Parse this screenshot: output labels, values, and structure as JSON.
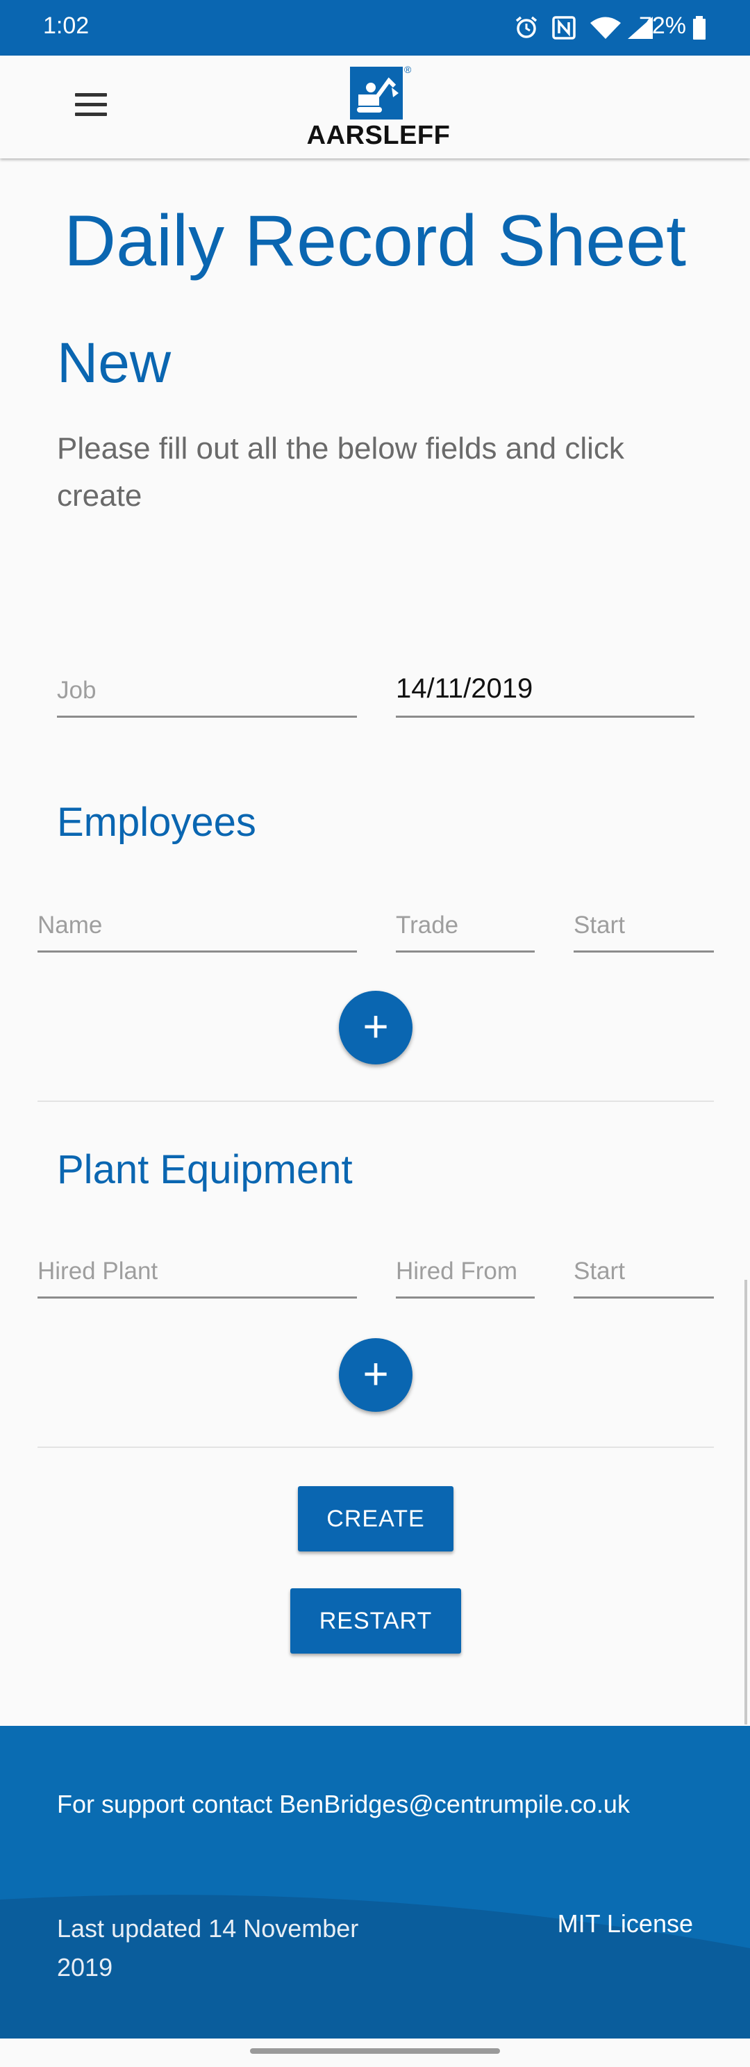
{
  "status_bar": {
    "time": "1:02",
    "battery_percent": "72%",
    "icons": [
      "alarm-icon",
      "nfc-icon",
      "wifi-icon",
      "signal-icon",
      "battery-icon"
    ]
  },
  "header": {
    "logo_text": "AARSLEFF",
    "logo_mark": "®"
  },
  "page": {
    "title": "Daily Record Sheet",
    "subtitle": "New",
    "description": "Please fill out all the below fields and click create"
  },
  "job_form": {
    "job_placeholder": "Job",
    "date_value": "14/11/2019"
  },
  "employees": {
    "heading": "Employees",
    "name_placeholder": "Name",
    "trade_placeholder": "Trade",
    "start_placeholder": "Start",
    "add_symbol": "+"
  },
  "plant": {
    "heading": "Plant Equipment",
    "hired_plant_placeholder": "Hired Plant",
    "hired_from_placeholder": "Hired From",
    "start_placeholder": "Start",
    "add_symbol": "+"
  },
  "actions": {
    "create_label": "CREATE",
    "restart_label": "RESTART"
  },
  "footer": {
    "support_text": "For support contact BenBridges@centrumpile.co.uk",
    "updated_text": "Last updated 14 November 2019",
    "license_text": "MIT License"
  },
  "colors": {
    "brand": "#0a66b1",
    "footer": "#0a6cb2"
  }
}
